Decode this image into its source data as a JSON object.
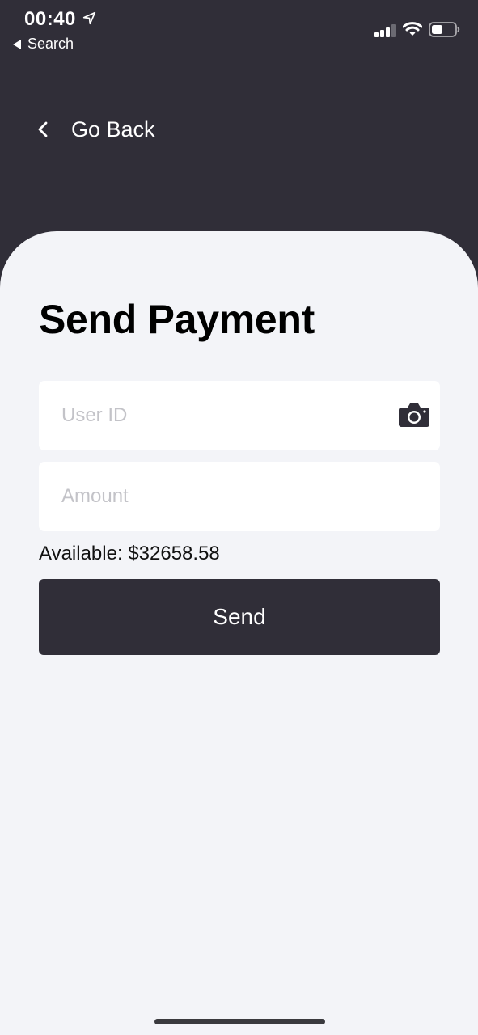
{
  "status_bar": {
    "time": "00:40",
    "back_app_label": "Search",
    "icons": [
      "location-arrow-icon",
      "cellular-signal-icon",
      "wifi-icon",
      "battery-icon"
    ]
  },
  "header": {
    "back_label": "Go Back",
    "back_icon": "chevron-left-icon"
  },
  "main": {
    "title": "Send Payment",
    "user_id": {
      "placeholder": "User ID",
      "value": "",
      "icon": "camera-icon"
    },
    "amount": {
      "placeholder": "Amount",
      "value": ""
    },
    "available": {
      "label": "Available:",
      "value": "$32658.58"
    },
    "send_label": "Send"
  },
  "colors": {
    "header_bg": "#302e38",
    "sheet_bg": "#f3f4f8",
    "field_bg": "#ffffff",
    "button_bg": "#302e38",
    "placeholder": "#c3c3c8"
  }
}
